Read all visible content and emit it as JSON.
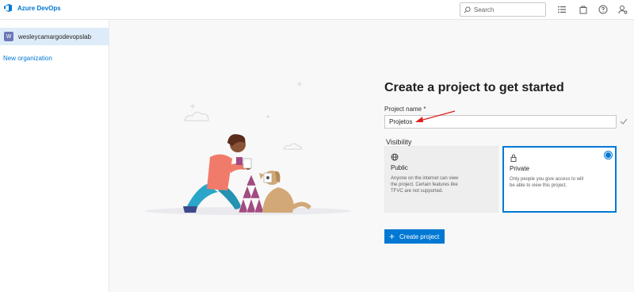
{
  "header": {
    "brand": "Azure DevOps",
    "search_placeholder": "Search",
    "icons": [
      "list-icon",
      "bag-icon",
      "help-icon",
      "user-settings-icon"
    ]
  },
  "sidebar": {
    "org_avatar": "W",
    "org_name": "wesleycamargodevopslab",
    "new_org": "New organization"
  },
  "form": {
    "title": "Create a project to get started",
    "name_label": "Project name *",
    "name_value": "Projetos",
    "visibility_label": "Visibility",
    "public": {
      "title": "Public",
      "desc": "Anyone on the internet can view the project. Certain features like TFVC are not supported."
    },
    "private": {
      "title": "Private",
      "desc": "Only people you give access to will be able to view this project.",
      "selected": true
    },
    "create_button": "Create project"
  },
  "colors": {
    "accent": "#0078d4",
    "annotation_arrow": "#e02020"
  }
}
